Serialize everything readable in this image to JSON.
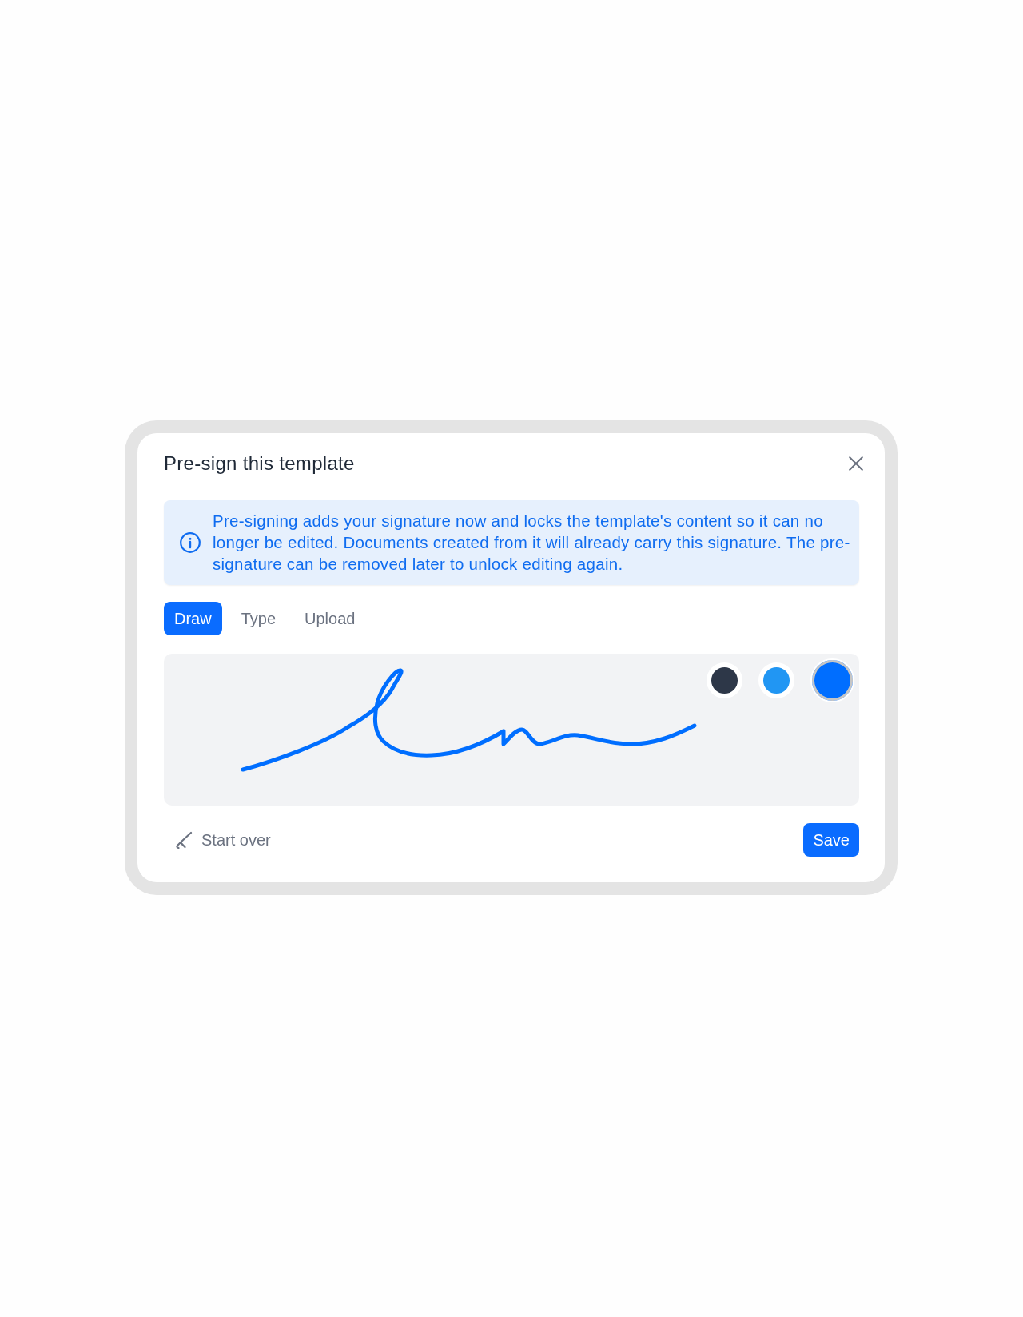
{
  "dialog": {
    "title": "Pre-sign this template"
  },
  "notice": {
    "text": "Pre-signing adds your signature now and locks the template's content so it can no longer be edited. Documents created from it will already carry this signature. The pre-signature can be removed later to unlock editing again."
  },
  "tabs": [
    {
      "label": "Draw",
      "selected": true
    },
    {
      "label": "Type",
      "selected": false
    },
    {
      "label": "Upload",
      "selected": false
    }
  ],
  "pad": {
    "colors": [
      {
        "color": "#2d3748",
        "selected": false
      },
      {
        "color": "#2196f3",
        "selected": false
      },
      {
        "color": "#006eff",
        "selected": true
      }
    ]
  },
  "actions": {
    "start_over": "Start over",
    "save": "Save"
  }
}
